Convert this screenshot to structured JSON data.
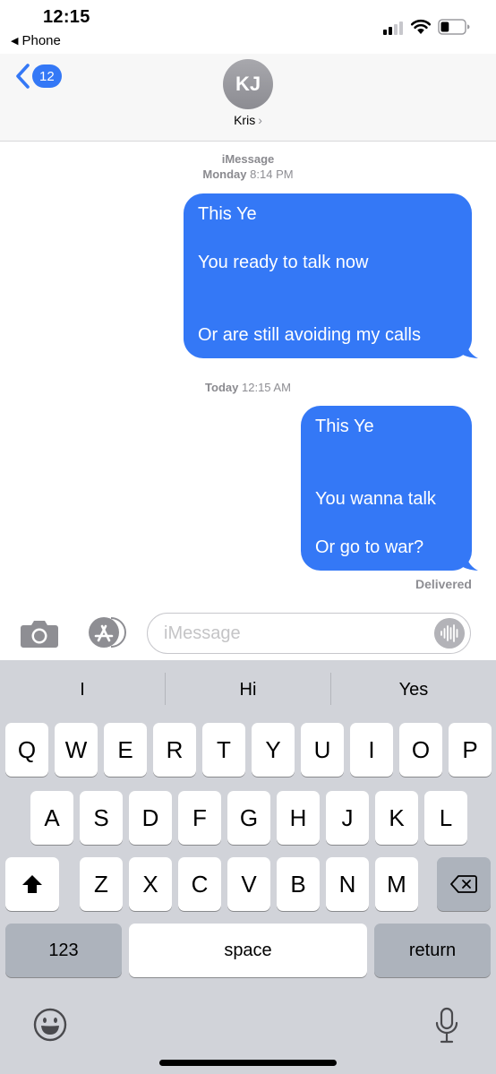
{
  "status_bar": {
    "time": "12:15",
    "back_app": "Phone",
    "signal_icon": "cellular-signal-icon",
    "wifi_icon": "wifi-icon",
    "battery_icon": "battery-icon",
    "battery_level": 0.35
  },
  "header": {
    "back_icon": "chevron-left-icon",
    "unread_count": "12",
    "avatar_initials": "KJ",
    "contact_name": "Kris",
    "contact_chevron": "›"
  },
  "conversation": {
    "service": "iMessage",
    "groups": [
      {
        "timestamp_day": "Monday",
        "timestamp_time": "8:14 PM",
        "message_lines": [
          "This Ye",
          "",
          "You ready to talk now",
          "",
          "",
          "Or are still avoiding my calls"
        ]
      },
      {
        "timestamp_day": "Today",
        "timestamp_time": "12:15 AM",
        "message_lines": [
          "This Ye",
          "",
          "",
          "You wanna talk",
          "",
          "Or go to war?"
        ]
      }
    ],
    "delivery_status": "Delivered"
  },
  "composer": {
    "camera_icon": "camera-icon",
    "apps_icon": "app-store-icon",
    "placeholder": "iMessage",
    "value": "",
    "audio_icon": "audio-waveform-icon"
  },
  "keyboard": {
    "suggestions": [
      "I",
      "Hi",
      "Yes"
    ],
    "row1": [
      "Q",
      "W",
      "E",
      "R",
      "T",
      "Y",
      "U",
      "I",
      "O",
      "P"
    ],
    "row2": [
      "A",
      "S",
      "D",
      "F",
      "G",
      "H",
      "J",
      "K",
      "L"
    ],
    "row3": [
      "Z",
      "X",
      "C",
      "V",
      "B",
      "N",
      "M"
    ],
    "shift_icon": "shift-arrow-icon",
    "delete_icon": "backspace-icon",
    "numbers_label": "123",
    "space_label": "space",
    "return_label": "return",
    "emoji_icon": "emoji-icon",
    "dictation_icon": "microphone-icon"
  },
  "colors": {
    "bubble_blue": "#3478f6",
    "keyboard_bg": "#d1d3d9",
    "function_key": "#adb3bc",
    "secondary_text": "#8e8e93"
  }
}
